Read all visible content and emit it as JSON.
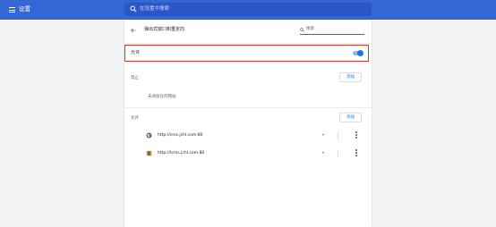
{
  "topbar": {
    "title": "设置",
    "search_placeholder": "在设置中搜索",
    "color": "#3367d6"
  },
  "page": {
    "title": "弹出式窗口和重定向",
    "filter_label": "搜索"
  },
  "main_toggle": {
    "label": "允许",
    "enabled": true,
    "highlight_color": "#e0342b"
  },
  "blocked": {
    "label": "禁止",
    "add_label": "添加",
    "empty_text": "未添加任何网站"
  },
  "allowed": {
    "label": "允许",
    "add_label": "添加",
    "sites": [
      {
        "url": "http://cms.jchl.com:80",
        "icon": "globe-icon"
      },
      {
        "url": "http://tcms.jchl.com:80",
        "icon": "site-favicon-icon"
      }
    ]
  },
  "icons": {
    "menu": "menu-icon",
    "search": "search-icon",
    "back": "back-arrow-icon",
    "more": "more-vert-icon",
    "dropdown": "chevron-down-icon"
  }
}
